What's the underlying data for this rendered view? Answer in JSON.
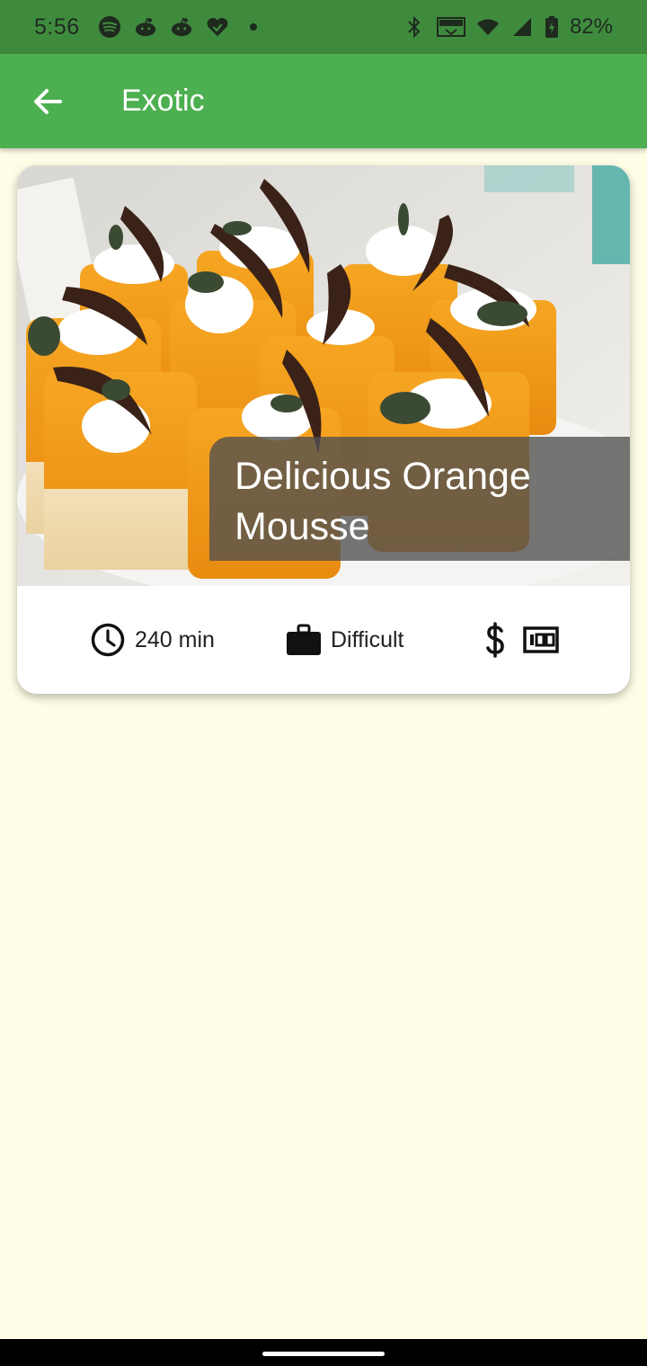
{
  "status_bar": {
    "time": "5:56",
    "battery": "82%",
    "left_icons": [
      "spotify-icon",
      "reddit-icon",
      "reddit-icon",
      "heart-check-icon",
      "dot-icon"
    ],
    "right_icons": [
      "bluetooth-icon",
      "vowifi-icon",
      "wifi-icon",
      "signal-icon",
      "battery-charging-icon"
    ]
  },
  "app_bar": {
    "title": "Exotic",
    "back_icon": "arrow-back-icon"
  },
  "meal_card": {
    "title": "Delicious Orange Mousse",
    "duration": "240 min",
    "complexity": "Difficult",
    "affordability_icons": [
      "dollar-icon",
      "money-icon"
    ]
  },
  "colors": {
    "status_bar": "#3F8B3E",
    "app_bar": "#4CAF50",
    "background": "#FFFDE6",
    "card": "#FFFFFF"
  }
}
